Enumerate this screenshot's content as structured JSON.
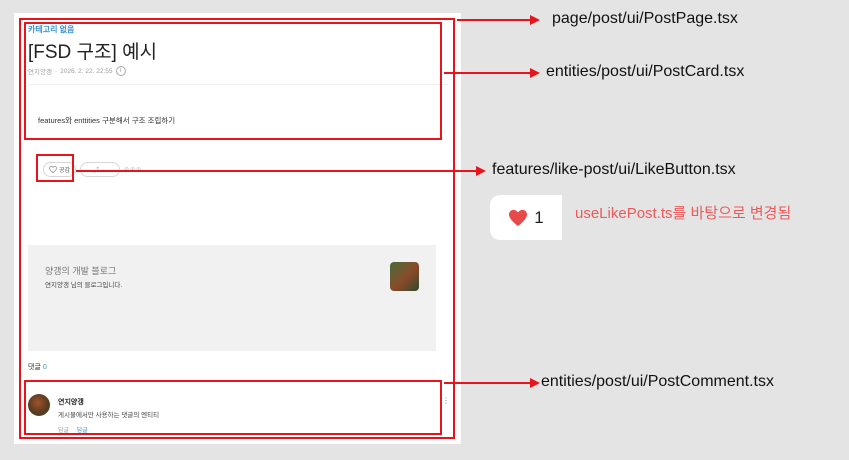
{
  "post": {
    "category": "카테고리 없음",
    "title": "[FSD 구조] 예시",
    "author": "연지양갱",
    "date": "2026. 2. 22. 22:55",
    "body": "features와 enttities 구분해서 구조 조립하기",
    "like_label": "공감"
  },
  "blog_card": {
    "name": "양갱의 개발 블로그",
    "description": "연지양갱 님의 블로그입니다."
  },
  "comments": {
    "label": "댓글",
    "count": "0",
    "items": [
      {
        "author": "연지양갱",
        "text": "게시물에서만 사용하는 댓글의 엔티티",
        "reply_prefix": "답글",
        "reply_link": "답글"
      }
    ]
  },
  "annotations": {
    "page": "page/post/ui/PostPage.tsx",
    "card": "entities/post/ui/PostCard.tsx",
    "like": "features/like-post/ui/LikeButton.tsx",
    "comment": "entities/post/ui/PostComment.tsx",
    "preview_count": "1",
    "note": "useLikePost.ts를 바탕으로 변경됨"
  },
  "colors": {
    "annotation_red": "#e8141b",
    "heart": "#e84a4a",
    "note": "#ee5a5a",
    "accent_blue": "#3b8fd3"
  },
  "icons": [
    "heart-icon",
    "info-icon",
    "kebab-menu-icon",
    "arrow-icon"
  ]
}
